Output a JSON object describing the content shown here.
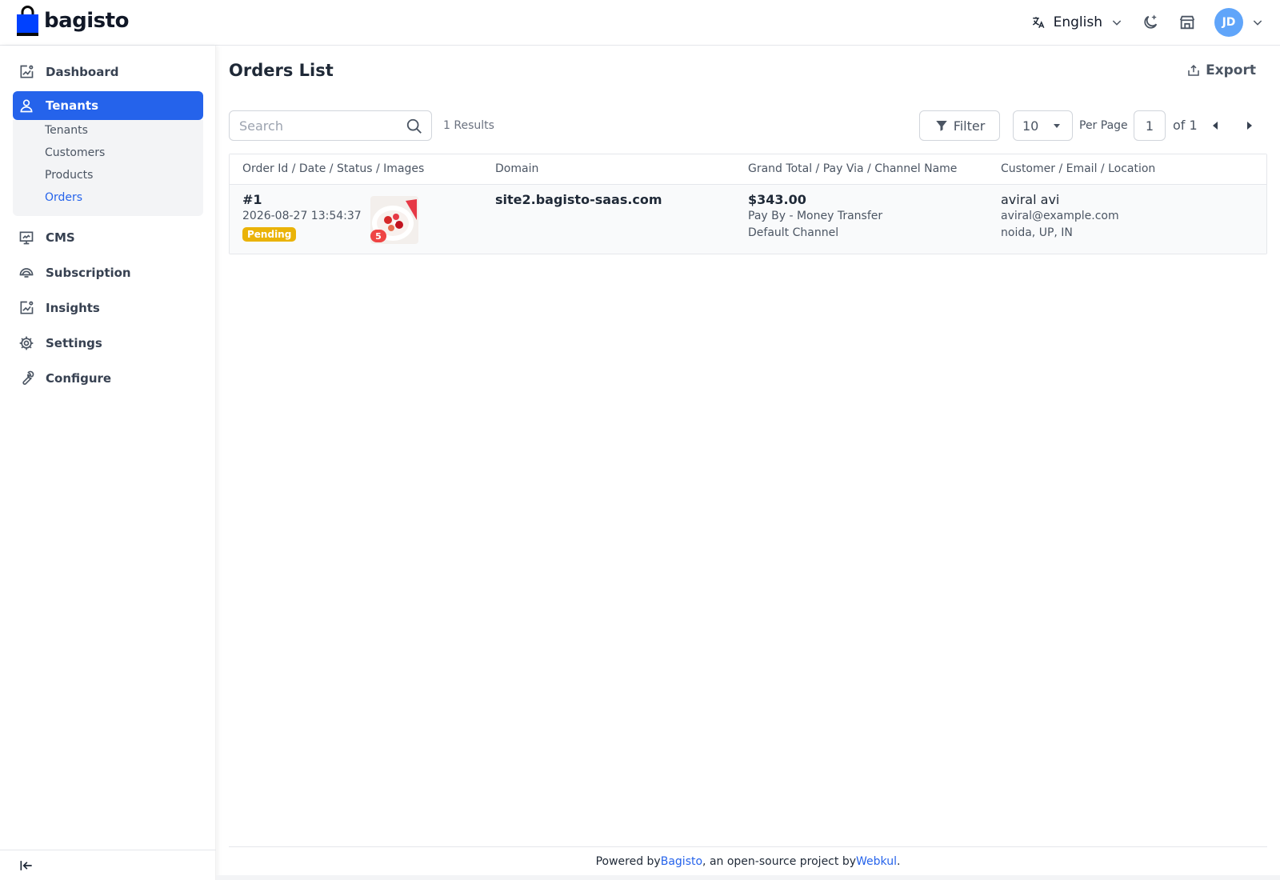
{
  "brand": {
    "name": "bagisto"
  },
  "header": {
    "language": "English",
    "avatar_initials": "JD"
  },
  "sidebar": {
    "items": [
      {
        "label": "Dashboard",
        "icon": "dashboard-icon"
      },
      {
        "label": "Tenants",
        "icon": "user-icon",
        "active": true
      },
      {
        "label": "CMS",
        "icon": "cms-icon"
      },
      {
        "label": "Subscription",
        "icon": "subscription-icon"
      },
      {
        "label": "Insights",
        "icon": "insights-icon"
      },
      {
        "label": "Settings",
        "icon": "gear-icon"
      },
      {
        "label": "Configure",
        "icon": "wrench-icon"
      }
    ],
    "submenu": [
      {
        "label": "Tenants"
      },
      {
        "label": "Customers"
      },
      {
        "label": "Products"
      },
      {
        "label": "Orders",
        "active": true
      }
    ]
  },
  "page": {
    "title": "Orders List",
    "export_label": "Export"
  },
  "toolbar": {
    "search_placeholder": "Search",
    "results": "1 Results",
    "filter_label": "Filter",
    "per_page_value": "10",
    "per_page_label": "Per Page",
    "page_value": "1",
    "of_label": "of 1"
  },
  "table": {
    "headers": [
      "Order Id / Date / Status / Images",
      "Domain",
      "Grand Total / Pay Via / Channel Name",
      "Customer / Email / Location"
    ],
    "rows": [
      {
        "order_id": "#1",
        "date": "2026-08-27 13:54:37",
        "status": "Pending",
        "image_count": "5",
        "domain": "site2.bagisto-saas.com",
        "grand_total": "$343.00",
        "pay_via": "Pay By - Money Transfer",
        "channel": "Default Channel",
        "customer": "aviral avi",
        "email": "aviral@example.com",
        "location": "noida, UP, IN"
      }
    ]
  },
  "footer": {
    "prefix": "Powered by ",
    "link1": "Bagisto",
    "middle": ", an open-source project by ",
    "link2": "Webkul",
    "suffix": "."
  },
  "colors": {
    "primary": "#2563eb",
    "pending": "#eab308",
    "badge_red": "#ef4444",
    "avatar": "#60a5fa"
  }
}
